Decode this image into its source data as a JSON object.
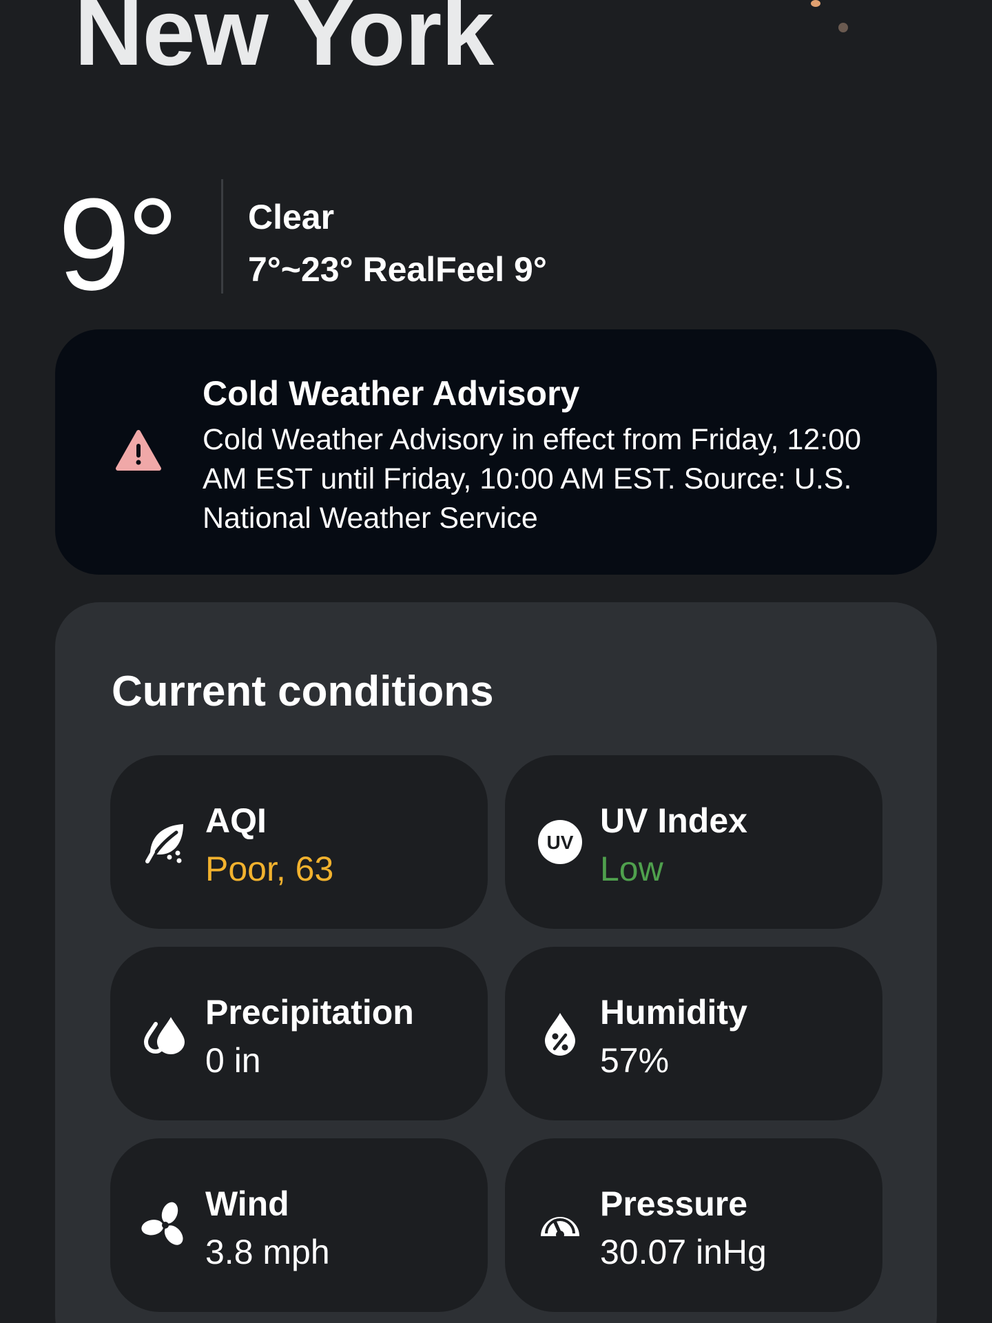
{
  "header": {
    "city": "New York"
  },
  "current": {
    "temperature": "9°",
    "condition": "Clear",
    "range_realfeel": "7°~23° RealFeel 9°"
  },
  "alert": {
    "title": "Cold Weather Advisory",
    "body": "Cold Weather Advisory in effect from Friday, 12:00 AM EST until Friday, 10:00 AM EST. Source: U.S. National Weather Service",
    "icon": "warning-triangle-icon",
    "icon_color": "#f0a8a8"
  },
  "conditions": {
    "title": "Current conditions",
    "tiles": [
      {
        "label": "AQI",
        "value": "Poor, 63",
        "icon": "leaf-icon",
        "value_color": "#f2b22e"
      },
      {
        "label": "UV Index",
        "value": "Low",
        "icon": "uv-icon",
        "value_color": "#4fa04d"
      },
      {
        "label": "Precipitation",
        "value": "0 in",
        "icon": "drops-icon",
        "value_color": "#ffffff"
      },
      {
        "label": "Humidity",
        "value": "57%",
        "icon": "humidity-icon",
        "value_color": "#ffffff"
      },
      {
        "label": "Wind",
        "value": "3.8 mph",
        "icon": "fan-icon",
        "value_color": "#ffffff"
      },
      {
        "label": "Pressure",
        "value": "30.07 inHg",
        "icon": "gauge-icon",
        "value_color": "#ffffff"
      }
    ]
  },
  "colors": {
    "background": "#1c1e21",
    "alert_background": "#060b13",
    "panel_background": "#2d3034",
    "tile_background": "#1c1e21"
  }
}
